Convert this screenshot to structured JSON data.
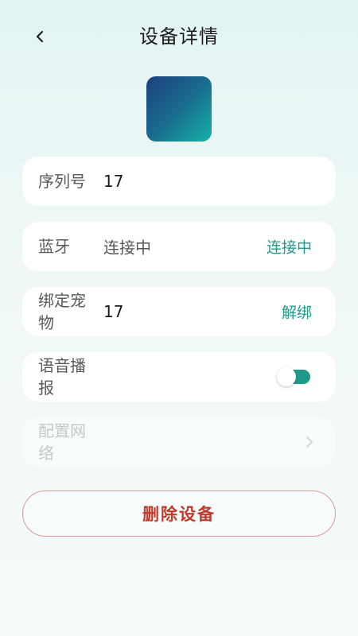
{
  "header": {
    "title": "设备详情",
    "back_icon": "chevron-left-icon"
  },
  "device": {
    "image": "device-thumbnail"
  },
  "rows": {
    "serial": {
      "label": "序列号",
      "value": "17"
    },
    "bluetooth": {
      "label": "蓝牙",
      "value": "连接中",
      "action": "连接中"
    },
    "pet": {
      "label": "绑定宠物",
      "value": "17",
      "action": "解绑"
    },
    "voice": {
      "label": "语音播报",
      "toggle_on": true
    },
    "network": {
      "label": "配置网络",
      "disabled": true,
      "icon": "chevron-right-icon"
    }
  },
  "delete_button": {
    "label": "删除设备"
  },
  "colors": {
    "accent": "#1f9a8a",
    "danger": "#c0392b",
    "background": "#e9f6f5"
  }
}
